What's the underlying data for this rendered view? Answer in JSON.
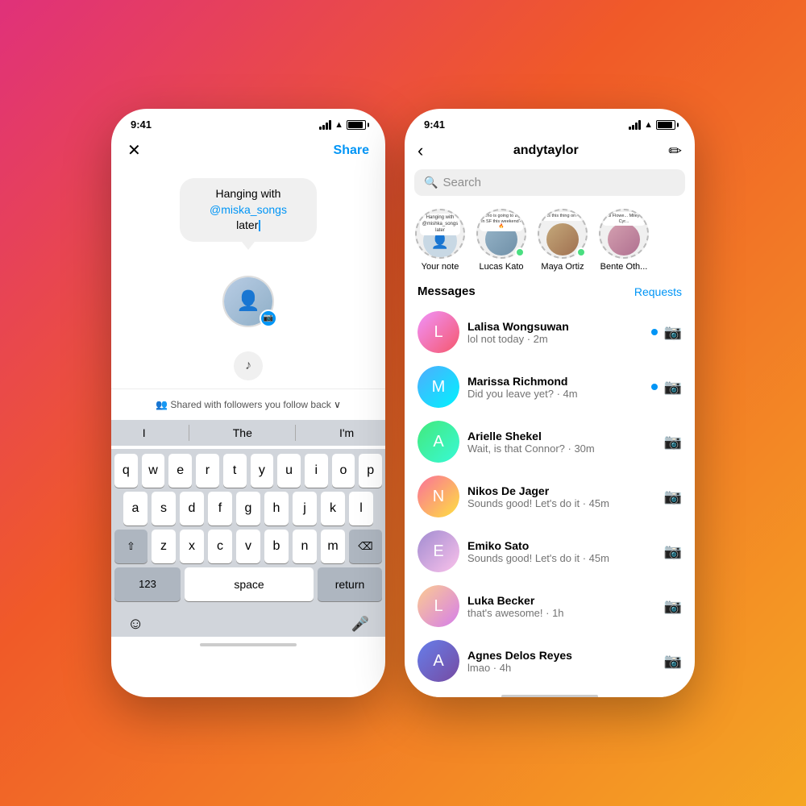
{
  "background": "gradient: pink to orange",
  "left_phone": {
    "status_bar": {
      "time": "9:41"
    },
    "header": {
      "close_label": "✕",
      "share_label": "Share"
    },
    "note_bubble": {
      "text_before_mention": "Hanging with ",
      "mention": "@miska_songs",
      "text_after_mention": " later"
    },
    "shared_with_text": "Shared with followers you follow back",
    "keyboard_suggestions": [
      "I",
      "The",
      "I'm"
    ],
    "keyboard_rows": [
      [
        "q",
        "w",
        "e",
        "r",
        "t",
        "y",
        "u",
        "i",
        "o",
        "p"
      ],
      [
        "a",
        "s",
        "d",
        "f",
        "g",
        "h",
        "j",
        "k",
        "l"
      ],
      [
        "z",
        "x",
        "c",
        "v",
        "b",
        "n",
        "m"
      ],
      [
        "123",
        "space",
        "return"
      ]
    ]
  },
  "right_phone": {
    "status_bar": {
      "time": "9:41"
    },
    "header": {
      "back_label": "‹",
      "username": "andytaylor",
      "edit_icon": "✏"
    },
    "search": {
      "placeholder": "Search"
    },
    "stories": [
      {
        "id": "your_note",
        "label": "Your note",
        "has_note": true,
        "note_text": "Hanging with @mishka_songs later",
        "type": "note"
      },
      {
        "id": "lucas_kato",
        "label": "Lucas Kato",
        "note_text": "Who is going to be in SF this weekend? 🔥✨",
        "type": "note_story",
        "online": true
      },
      {
        "id": "maya_ortiz",
        "label": "Maya Ortiz",
        "note_text": "Is this thing on?",
        "type": "note_story",
        "online": true
      },
      {
        "id": "bente_oth",
        "label": "Bente Oth...",
        "note_text": "lil Flowe... Miley Cyr...",
        "type": "story"
      }
    ],
    "messages_header": {
      "title": "Messages",
      "requests": "Requests"
    },
    "messages": [
      {
        "name": "Lalisa Wongsuwan",
        "preview": "lol not today · 2m",
        "unread": true,
        "color": "av1"
      },
      {
        "name": "Marissa Richmond",
        "preview": "Did you leave yet? · 4m",
        "unread": true,
        "color": "av2"
      },
      {
        "name": "Arielle Shekel",
        "preview": "Wait, is that Connor? · 30m",
        "unread": false,
        "color": "av3"
      },
      {
        "name": "Nikos De Jager",
        "preview": "Sounds good! Let's do it · 45m",
        "unread": false,
        "color": "av4"
      },
      {
        "name": "Emiko Sato",
        "preview": "Sounds good! Let's do it · 45m",
        "unread": false,
        "color": "av5"
      },
      {
        "name": "Luka Becker",
        "preview": "that's awesome! · 1h",
        "unread": false,
        "color": "av6"
      },
      {
        "name": "Agnes Delos Reyes",
        "preview": "lmao · 4h",
        "unread": false,
        "color": "av7"
      }
    ]
  }
}
